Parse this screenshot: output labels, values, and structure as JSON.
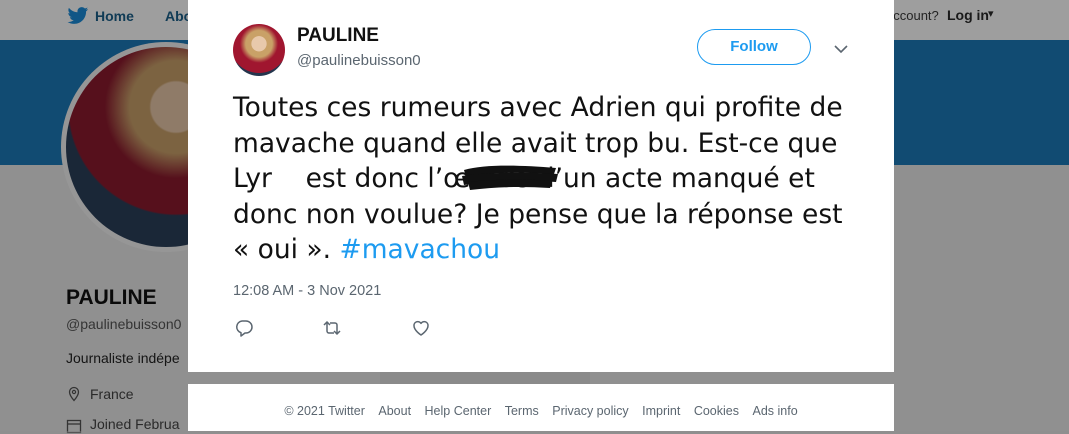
{
  "nav": {
    "home_label": "Home",
    "about_label": "Abo",
    "account_prompt": "account?",
    "login_label": "Log in",
    "caret": "▾"
  },
  "profile": {
    "name": "PAULINE",
    "handle": "@paulinebuisson0",
    "bio": "Journaliste indépe",
    "location": "France",
    "joined": "Joined Februa"
  },
  "tweet": {
    "name": "PAULINE",
    "handle": "@paulinebuisson0",
    "follow_label": "Follow",
    "text_part1": "Toutes ces rumeurs avec Adrien qui profite de mavache quand elle avait trop bu. Est-ce que ",
    "text_redacted": "Lyr    ",
    "text_part2": "est donc l’œuvre d’un acte manqué et donc non voulue? Je pense que la réponse est « oui ». ",
    "hashtag": "#mavachou",
    "timestamp": "12:08 AM - 3 Nov 2021"
  },
  "footer": {
    "links": [
      "© 2021 Twitter",
      "About",
      "Help Center",
      "Terms",
      "Privacy policy",
      "Imprint",
      "Cookies",
      "Ads info"
    ]
  },
  "colors": {
    "accent": "#1d9bf0",
    "banner": "#1c7ab8"
  },
  "icons": {
    "logo": "twitter-bird-icon",
    "more": "chevron-down-icon",
    "reply": "reply-icon",
    "retweet": "retweet-icon",
    "like": "heart-icon",
    "location": "location-pin-icon",
    "joined": "calendar-icon"
  }
}
